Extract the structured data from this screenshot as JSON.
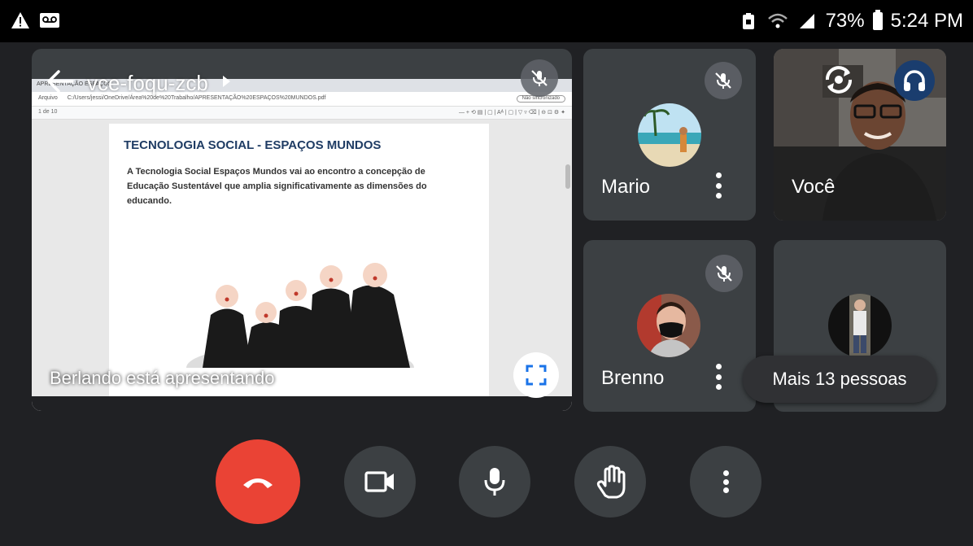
{
  "status_bar": {
    "warning_icon": "warning-icon",
    "voicemail_icon": "voicemail-icon",
    "battery_percent": "73%",
    "time": "5:24 PM"
  },
  "presentation": {
    "meeting_code": "vce-foqu-zcb",
    "presenter_label": "Berlando está apresentando",
    "browser": {
      "tab_text": "APRESENTAÇÃO ESPAÇOS",
      "url": "C:/Users/jessi/OneDrive/Área%20de%20Trabalho/APRESENTAÇÃO%20ESPAÇOS%20MUNDOS.pdf",
      "url_prefix": "Arquivo",
      "sync_pill": "Não sincronizado",
      "page_info": "1  de 10"
    },
    "document": {
      "title": "TECNOLOGIA SOCIAL - ESPAÇOS MUNDOS",
      "body": "A Tecnologia Social Espaços Mundos vai ao encontro a concepção de Educação Sustentável que amplia significativamente as dimensões do educando."
    }
  },
  "participants": [
    {
      "name": "Mario",
      "muted": true
    },
    {
      "name": "Você",
      "muted": false
    },
    {
      "name": "Brenno",
      "muted": true
    }
  ],
  "more_people": "Mais 13 pessoas",
  "controls": {
    "end_call": "end-call-icon",
    "camera": "camera-icon",
    "mic": "mic-icon",
    "raise_hand": "raise-hand-icon",
    "more": "more-options-icon"
  },
  "colors": {
    "end_call": "#ea4335",
    "tile_bg": "#3c4043",
    "accent": "#1a73e8"
  }
}
